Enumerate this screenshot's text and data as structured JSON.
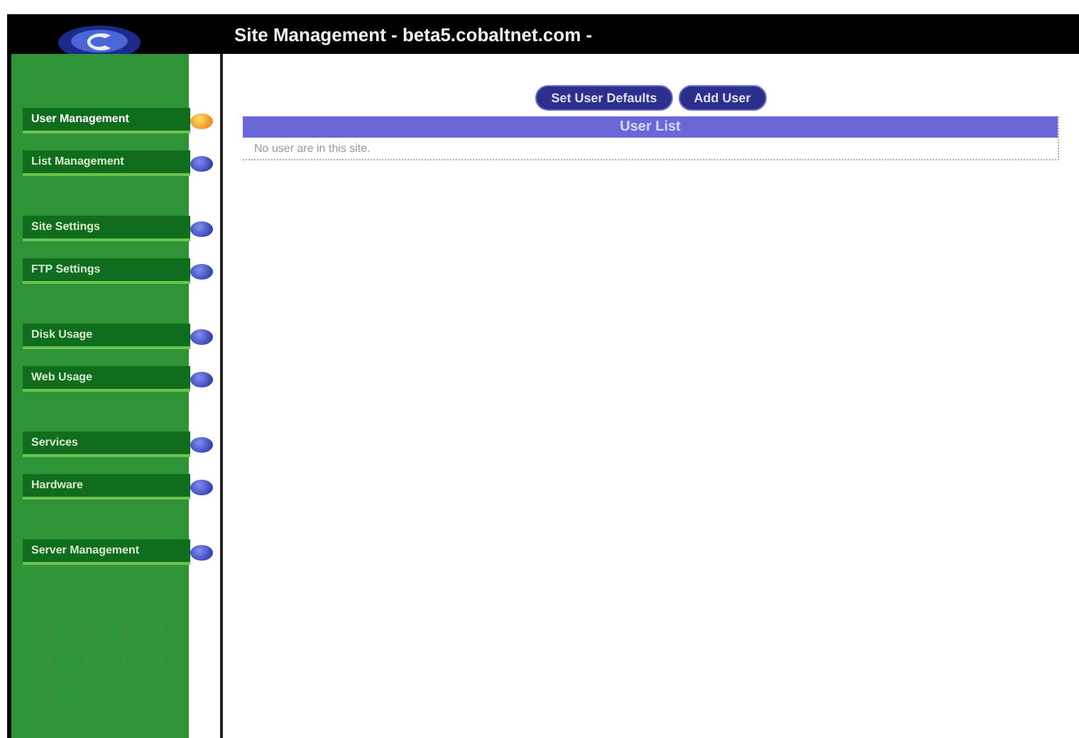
{
  "window": {
    "title": "Site Management - beta5.cobaltnet.com -"
  },
  "sidebar": {
    "sections": [
      {
        "items": [
          {
            "label": "User Management",
            "selected": true
          },
          {
            "label": "List Management",
            "selected": false
          }
        ]
      },
      {
        "items": [
          {
            "label": "Site Settings",
            "selected": false
          },
          {
            "label": "FTP Settings",
            "selected": false
          }
        ]
      },
      {
        "items": [
          {
            "label": "Disk Usage",
            "selected": false
          },
          {
            "label": "Web Usage",
            "selected": false
          }
        ]
      },
      {
        "items": [
          {
            "label": "Services",
            "selected": false
          },
          {
            "label": "Hardware",
            "selected": false
          }
        ]
      },
      {
        "items": [
          {
            "label": "Server Management",
            "selected": false
          }
        ]
      }
    ]
  },
  "buttons": [
    "Set User Defaults",
    "Add User"
  ],
  "table": {
    "title": "User List",
    "rows": [
      "No user are in this site."
    ]
  }
}
